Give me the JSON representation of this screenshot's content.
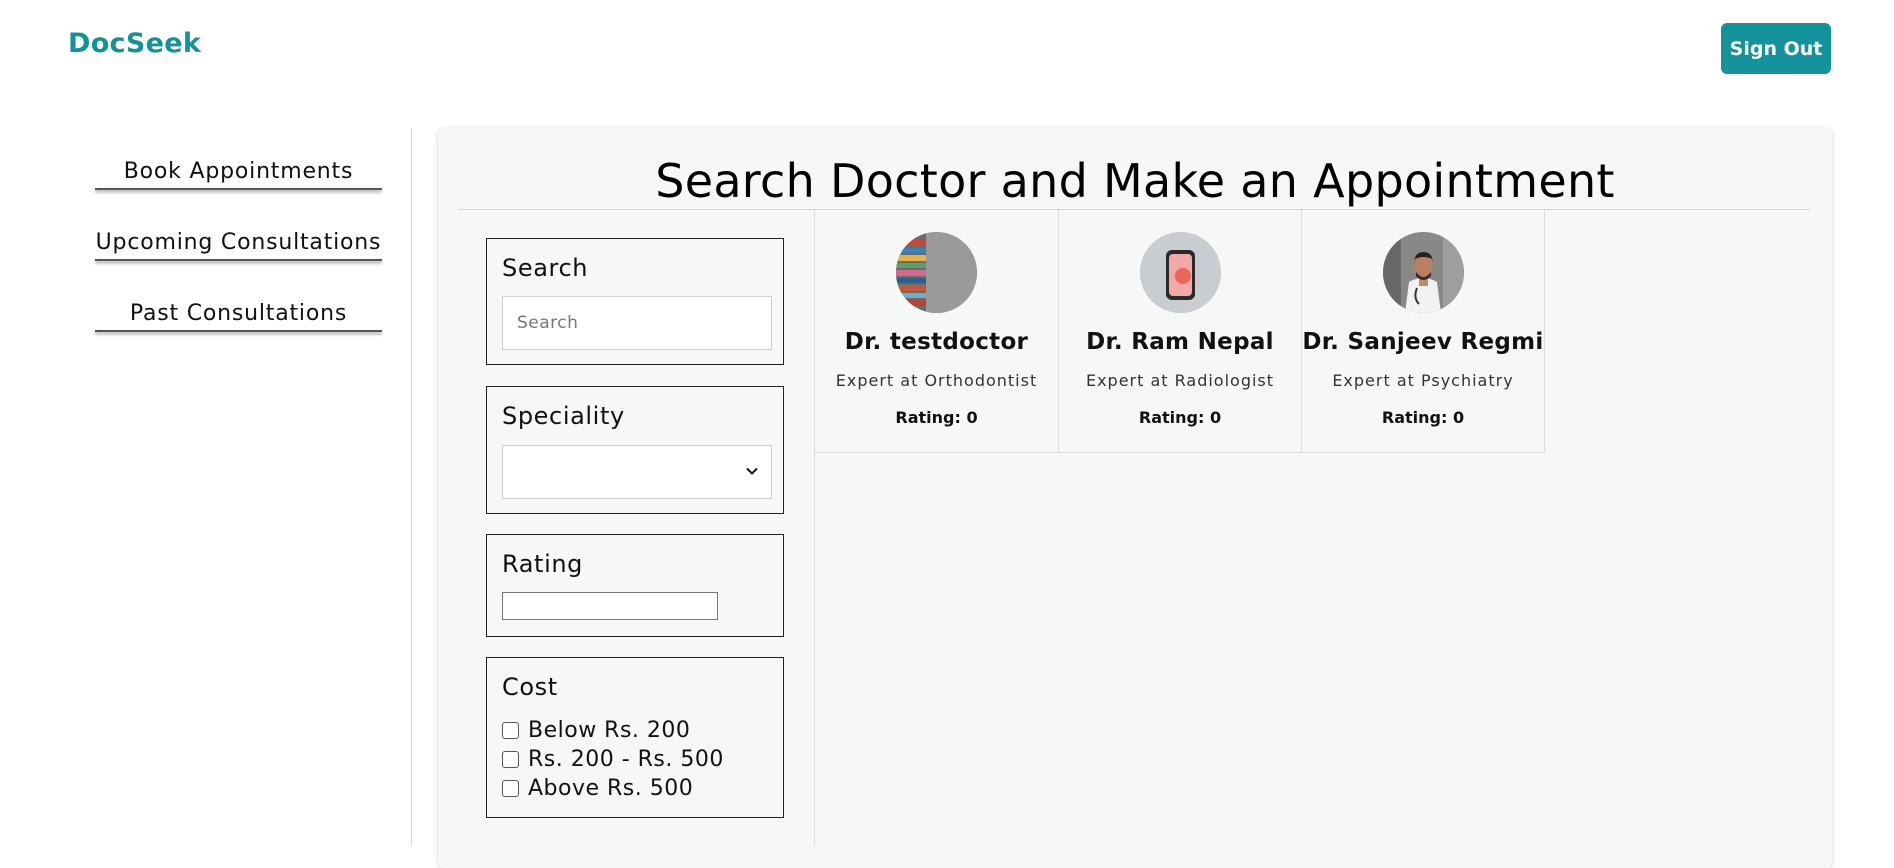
{
  "header": {
    "brand": "DocSeek",
    "sign_out": "Sign Out"
  },
  "sidebar": {
    "items": [
      {
        "label": "Book Appointments"
      },
      {
        "label": "Upcoming Consultations"
      },
      {
        "label": "Past Consultations"
      }
    ]
  },
  "main": {
    "title": "Search Doctor and Make an Appointment",
    "filters": {
      "search": {
        "label": "Search",
        "placeholder": "Search",
        "value": ""
      },
      "speciality": {
        "label": "Speciality",
        "selected": ""
      },
      "rating": {
        "label": "Rating",
        "value": ""
      },
      "cost": {
        "label": "Cost",
        "options": [
          {
            "label": "Below Rs. 200",
            "checked": false
          },
          {
            "label": "Rs. 200 - Rs. 500",
            "checked": false
          },
          {
            "label": "Above Rs. 500",
            "checked": false
          }
        ]
      }
    },
    "doctors": [
      {
        "name": "Dr. testdoctor",
        "speciality": "Expert at Orthodontist",
        "rating": "Rating: 0"
      },
      {
        "name": "Dr. Ram Nepal",
        "speciality": "Expert at Radiologist",
        "rating": "Rating: 0"
      },
      {
        "name": "Dr. Sanjeev Regmi",
        "speciality": "Expert at Psychiatry",
        "rating": "Rating: 0"
      }
    ]
  },
  "colors": {
    "brand": "#14919b",
    "button": "#14939c",
    "panel_bg": "#f6f7f7"
  }
}
